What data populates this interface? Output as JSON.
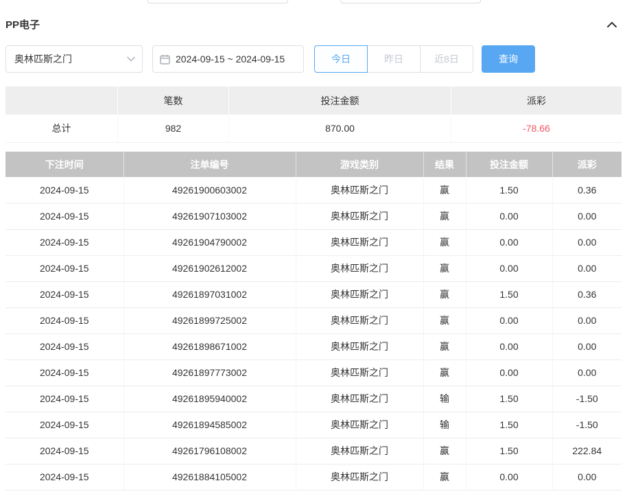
{
  "header": {
    "title": "PP电子"
  },
  "filters": {
    "game_select": "奥林匹斯之门",
    "date_range": "2024-09-15 ~ 2024-09-15",
    "quick": [
      {
        "label": "今日",
        "active": true
      },
      {
        "label": "昨日",
        "active": false
      },
      {
        "label": "近8日",
        "active": false
      }
    ],
    "search": "查询"
  },
  "summary": {
    "headers": {
      "count": "笔数",
      "amount": "投注金额",
      "payout": "派彩"
    },
    "total_label": "总计",
    "count": "982",
    "amount": "870.00",
    "payout": "-78.66"
  },
  "table": {
    "headers": [
      "下注时间",
      "注单编号",
      "游戏类别",
      "结果",
      "投注金额",
      "派彩"
    ],
    "rows": [
      {
        "time": "2024-09-15",
        "id": "49261900603002",
        "game": "奥林匹斯之门",
        "result": "赢",
        "amount": "1.50",
        "payout": "0.36",
        "neg": false
      },
      {
        "time": "2024-09-15",
        "id": "49261907103002",
        "game": "奥林匹斯之门",
        "result": "赢",
        "amount": "0.00",
        "payout": "0.00",
        "neg": false
      },
      {
        "time": "2024-09-15",
        "id": "49261904790002",
        "game": "奥林匹斯之门",
        "result": "赢",
        "amount": "0.00",
        "payout": "0.00",
        "neg": false
      },
      {
        "time": "2024-09-15",
        "id": "49261902612002",
        "game": "奥林匹斯之门",
        "result": "赢",
        "amount": "0.00",
        "payout": "0.00",
        "neg": false
      },
      {
        "time": "2024-09-15",
        "id": "49261897031002",
        "game": "奥林匹斯之门",
        "result": "赢",
        "amount": "1.50",
        "payout": "0.36",
        "neg": false
      },
      {
        "time": "2024-09-15",
        "id": "49261899725002",
        "game": "奥林匹斯之门",
        "result": "赢",
        "amount": "0.00",
        "payout": "0.00",
        "neg": false
      },
      {
        "time": "2024-09-15",
        "id": "49261898671002",
        "game": "奥林匹斯之门",
        "result": "赢",
        "amount": "0.00",
        "payout": "0.00",
        "neg": false
      },
      {
        "time": "2024-09-15",
        "id": "49261897773002",
        "game": "奥林匹斯之门",
        "result": "赢",
        "amount": "0.00",
        "payout": "0.00",
        "neg": false
      },
      {
        "time": "2024-09-15",
        "id": "49261895940002",
        "game": "奥林匹斯之门",
        "result": "输",
        "amount": "1.50",
        "payout": "-1.50",
        "neg": true
      },
      {
        "time": "2024-09-15",
        "id": "49261894585002",
        "game": "奥林匹斯之门",
        "result": "输",
        "amount": "1.50",
        "payout": "-1.50",
        "neg": true
      },
      {
        "time": "2024-09-15",
        "id": "49261796108002",
        "game": "奥林匹斯之门",
        "result": "赢",
        "amount": "1.50",
        "payout": "222.84",
        "neg": false
      },
      {
        "time": "2024-09-15",
        "id": "49261884105002",
        "game": "奥林匹斯之门",
        "result": "赢",
        "amount": "0.00",
        "payout": "0.00",
        "neg": false
      }
    ]
  },
  "colors": {
    "accent": "#58a7f3",
    "negative": "#ef5964",
    "header_gray": "#c3c3c3",
    "summary_gray": "#eeeeee"
  }
}
